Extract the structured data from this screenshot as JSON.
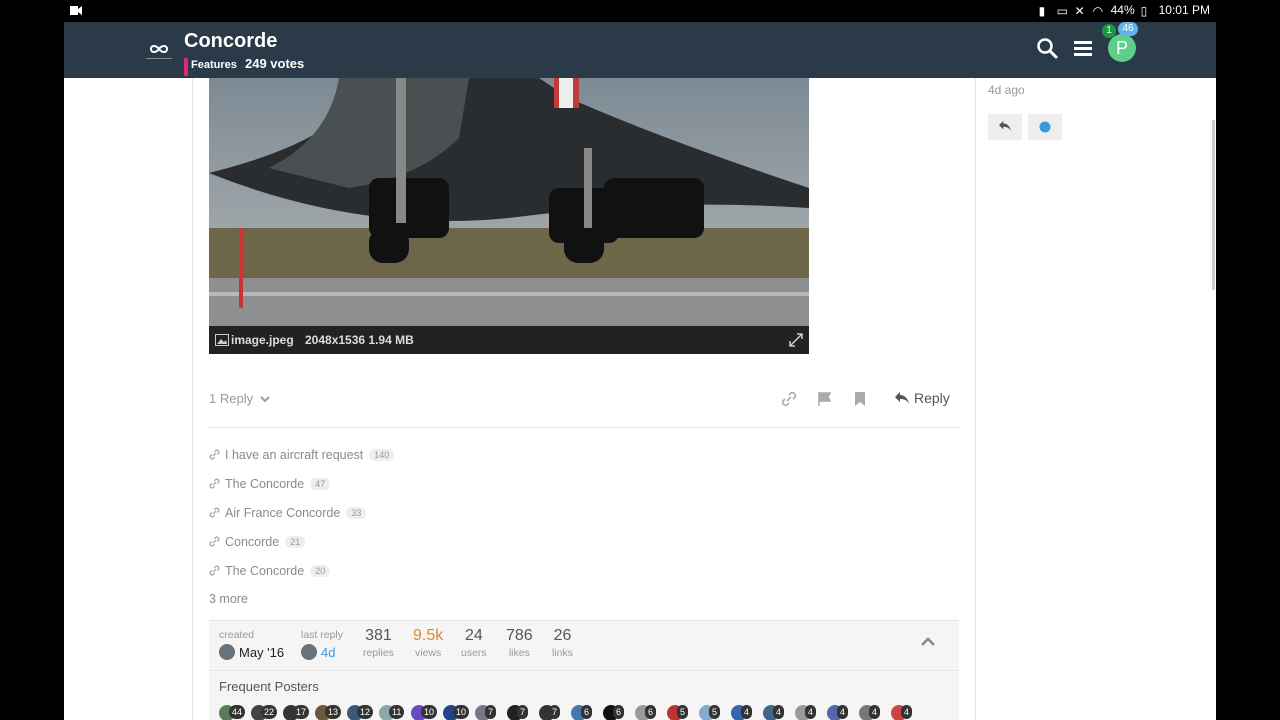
{
  "status_bar": {
    "battery": "44%",
    "time": "10:01 PM"
  },
  "header": {
    "title": "Concorde",
    "category": "Features",
    "votes": "249 votes",
    "notifications_green": "1",
    "notifications_blue": "46",
    "avatar_letter": "P"
  },
  "image": {
    "filename": "image.jpeg",
    "info": "2048x1536 1.94 MB"
  },
  "post_actions": {
    "reply_count": "1 Reply",
    "reply_label": "Reply"
  },
  "linked_topics": [
    {
      "title": "I have an aircraft request",
      "count": "140"
    },
    {
      "title": "The Concorde",
      "count": "47"
    },
    {
      "title": "Air France Concorde",
      "count": "33"
    },
    {
      "title": "Concorde",
      "count": "21"
    },
    {
      "title": "The Concorde",
      "count": "20"
    }
  ],
  "more_links": "3 more",
  "topic_map": {
    "created_label": "created",
    "created_value": "May '16",
    "last_reply_label": "last reply",
    "last_reply_value": "4d",
    "stats": [
      {
        "num": "381",
        "label": "replies",
        "color": "#555555"
      },
      {
        "num": "9.5k",
        "label": "views",
        "color": "#e08a2c"
      },
      {
        "num": "24",
        "label": "users",
        "color": "#555555"
      },
      {
        "num": "786",
        "label": "likes",
        "color": "#555555"
      },
      {
        "num": "26",
        "label": "links",
        "color": "#555555"
      }
    ],
    "frequent_posters_title": "Frequent Posters",
    "frequent_posters": [
      "44",
      "22",
      "17",
      "13",
      "12",
      "11",
      "10",
      "10",
      "7",
      "7",
      "7",
      "6",
      "6",
      "6",
      "5",
      "5",
      "4",
      "4",
      "4",
      "4",
      "4",
      "4"
    ]
  },
  "timeline": {
    "ago": "4d ago"
  },
  "colors": {
    "header_bg": "#2a3a48",
    "category": "#e0267a",
    "accent_blue": "#3b9bd9"
  }
}
